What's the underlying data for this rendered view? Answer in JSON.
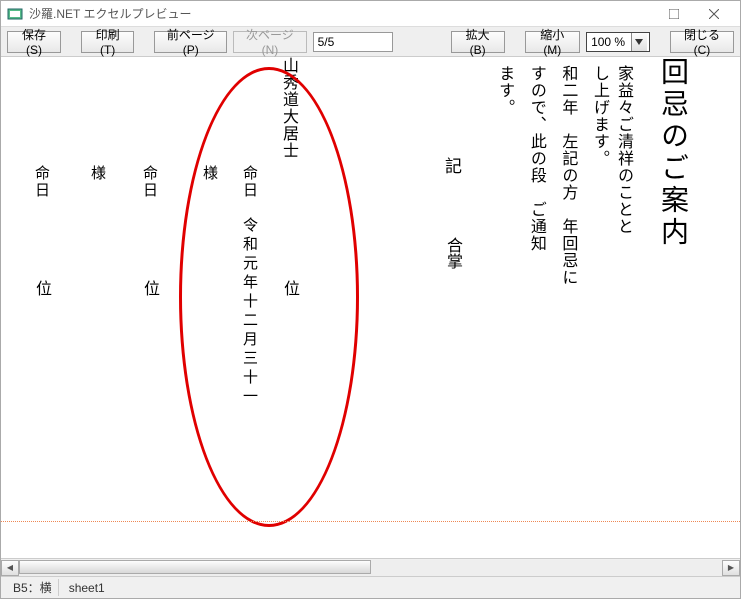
{
  "window": {
    "title": "沙羅.NET エクセルプレビュー"
  },
  "toolbar": {
    "save": "保存(S)",
    "print": "印刷(T)",
    "prev": "前ページ(P)",
    "next": "次ページ(N)",
    "page_field": "5/5",
    "zoom_in": "拡大(B)",
    "zoom_out": "縮小(M)",
    "zoom_value": "100 %",
    "close": "閉じる(C)"
  },
  "doc": {
    "title_col": "回忌のご案内",
    "body1": "家益々ご清祥のことと",
    "body2a": "し上げます。",
    "body2b": "和二年　左記の方　年回忌に",
    "body2c": "すので、此の段　ご通知",
    "body2d": "ます。",
    "ki": "記",
    "gassho": "合掌",
    "name": "山秀道大居士",
    "small": "命日",
    "samalabel": "様",
    "posunit": "位",
    "date": "令和元年十二月三十一"
  },
  "status": {
    "cell": "B5：横",
    "sheet": "sheet1"
  }
}
